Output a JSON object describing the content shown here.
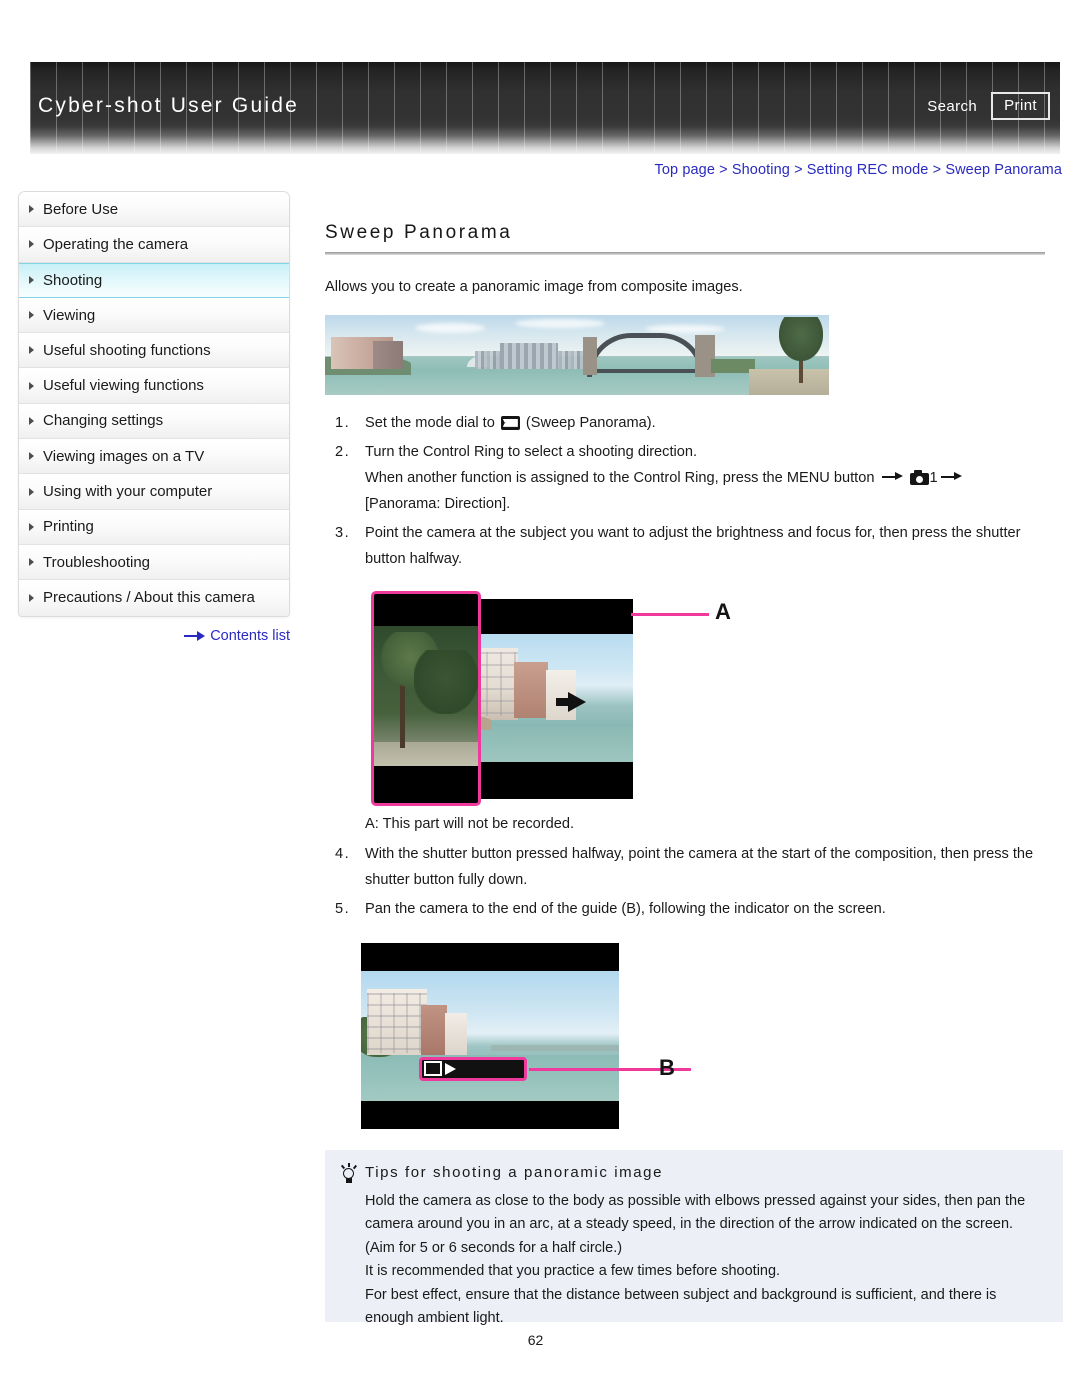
{
  "header": {
    "title": "Cyber-shot User Guide",
    "search_label": "Search",
    "print_label": "Print"
  },
  "breadcrumb": {
    "items": [
      "Top page",
      "Shooting",
      "Setting REC mode",
      "Sweep Panorama"
    ],
    "separator": ">"
  },
  "sidebar": {
    "items": [
      {
        "label": "Before Use",
        "active": false
      },
      {
        "label": "Operating the camera",
        "active": false
      },
      {
        "label": "Shooting",
        "active": true
      },
      {
        "label": "Viewing",
        "active": false
      },
      {
        "label": "Useful shooting functions",
        "active": false
      },
      {
        "label": "Useful viewing functions",
        "active": false
      },
      {
        "label": "Changing settings",
        "active": false
      },
      {
        "label": "Viewing images on a TV",
        "active": false
      },
      {
        "label": "Using with your computer",
        "active": false
      },
      {
        "label": "Printing",
        "active": false
      },
      {
        "label": "Troubleshooting",
        "active": false
      },
      {
        "label": "Precautions / About this camera",
        "active": false
      }
    ],
    "contents_link": "Contents list"
  },
  "main": {
    "title": "Sweep Panorama",
    "intro": "Allows you to create a panoramic image from composite images.",
    "steps": {
      "s1_num": "1.",
      "s1_pre": "Set the mode dial to ",
      "s1_post": " (Sweep Panorama).",
      "s2_num": "2.",
      "s2_line1": "Turn the Control Ring to select a shooting direction.",
      "s2_line2_pre": "When another function is assigned to the Control Ring, press the MENU button ",
      "s2_line2_mid": "1",
      "s2_line3": "[Panorama: Direction].",
      "s3_num": "3.",
      "s3_text": "Point the camera at the subject you want to adjust the brightness and focus for, then press the shutter button halfway.",
      "s4_num": "4.",
      "s4_text": "With the shutter button pressed halfway, point the camera at the start of the composition, then press the shutter button fully down.",
      "s5_num": "5.",
      "s5_text": "Pan the camera to the end of the guide (B), following the indicator on the screen."
    },
    "figure_a_label": "A",
    "figure_a_note": "A: This part will not be recorded.",
    "figure_b_label": "B"
  },
  "tips": {
    "heading": "Tips for shooting a panoramic image",
    "paragraphs": [
      "Hold the camera as close to the body as possible with elbows pressed against your sides, then pan the camera around you in an arc, at a steady speed, in the direction of the arrow indicated on the screen. (Aim for 5 or 6 seconds for a half circle.)",
      "It is recommended that you practice a few times before shooting.",
      "For best effect, ensure that the distance between subject and background is sufficient, and there is enough ambient light."
    ]
  },
  "footer": {
    "page_number": "62"
  },
  "colors": {
    "link": "#2a2ac0",
    "highlight": "#c8f0f7",
    "accent_pink": "#f0399c",
    "tips_bg": "#eceff5"
  }
}
